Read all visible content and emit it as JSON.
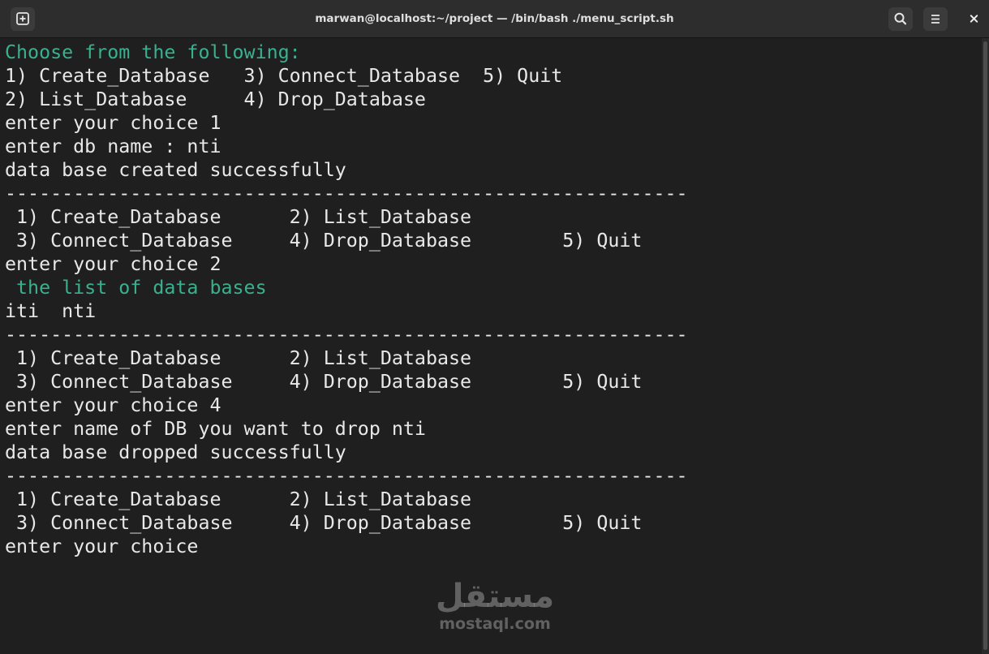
{
  "window": {
    "title": "marwan@localhost:~/project — /bin/bash ./menu_script.sh"
  },
  "toolbar": {
    "new_tab_icon": "new-tab-icon",
    "search_icon": "search-icon",
    "menu_icon": "hamburger-menu-icon",
    "close_icon": "close-icon",
    "close_glyph": "✕"
  },
  "terminal": {
    "colors": {
      "background": "#1f1f1f",
      "text": "#e8e8e8",
      "accent": "#3bb08e"
    },
    "lines": [
      {
        "text": "Choose from the following:",
        "accent": true
      },
      {
        "text": "1) Create_Database   3) Connect_Database  5) Quit",
        "accent": false
      },
      {
        "text": "2) List_Database     4) Drop_Database",
        "accent": false
      },
      {
        "text": "enter your choice 1",
        "accent": false
      },
      {
        "text": "enter db name : nti",
        "accent": false
      },
      {
        "text": "data base created successfully",
        "accent": false
      },
      {
        "text": "------------------------------------------------------------",
        "accent": false
      },
      {
        "text": " 1) Create_Database      2) List_Database",
        "accent": false
      },
      {
        "text": " 3) Connect_Database     4) Drop_Database        5) Quit",
        "accent": false
      },
      {
        "text": "enter your choice 2",
        "accent": false
      },
      {
        "text": " the list of data bases",
        "accent": true
      },
      {
        "text": "iti  nti",
        "accent": false
      },
      {
        "text": "------------------------------------------------------------",
        "accent": false
      },
      {
        "text": " 1) Create_Database      2) List_Database",
        "accent": false
      },
      {
        "text": " 3) Connect_Database     4) Drop_Database        5) Quit",
        "accent": false
      },
      {
        "text": "enter your choice 4",
        "accent": false
      },
      {
        "text": "enter name of DB you want to drop nti",
        "accent": false
      },
      {
        "text": "data base dropped successfully",
        "accent": false
      },
      {
        "text": "------------------------------------------------------------",
        "accent": false
      },
      {
        "text": " 1) Create_Database      2) List_Database",
        "accent": false
      },
      {
        "text": " 3) Connect_Database     4) Drop_Database        5) Quit",
        "accent": false
      },
      {
        "text": "enter your choice",
        "accent": false
      }
    ]
  },
  "watermark": {
    "logo_text": "مستقل",
    "domain": "mostaql.com"
  }
}
